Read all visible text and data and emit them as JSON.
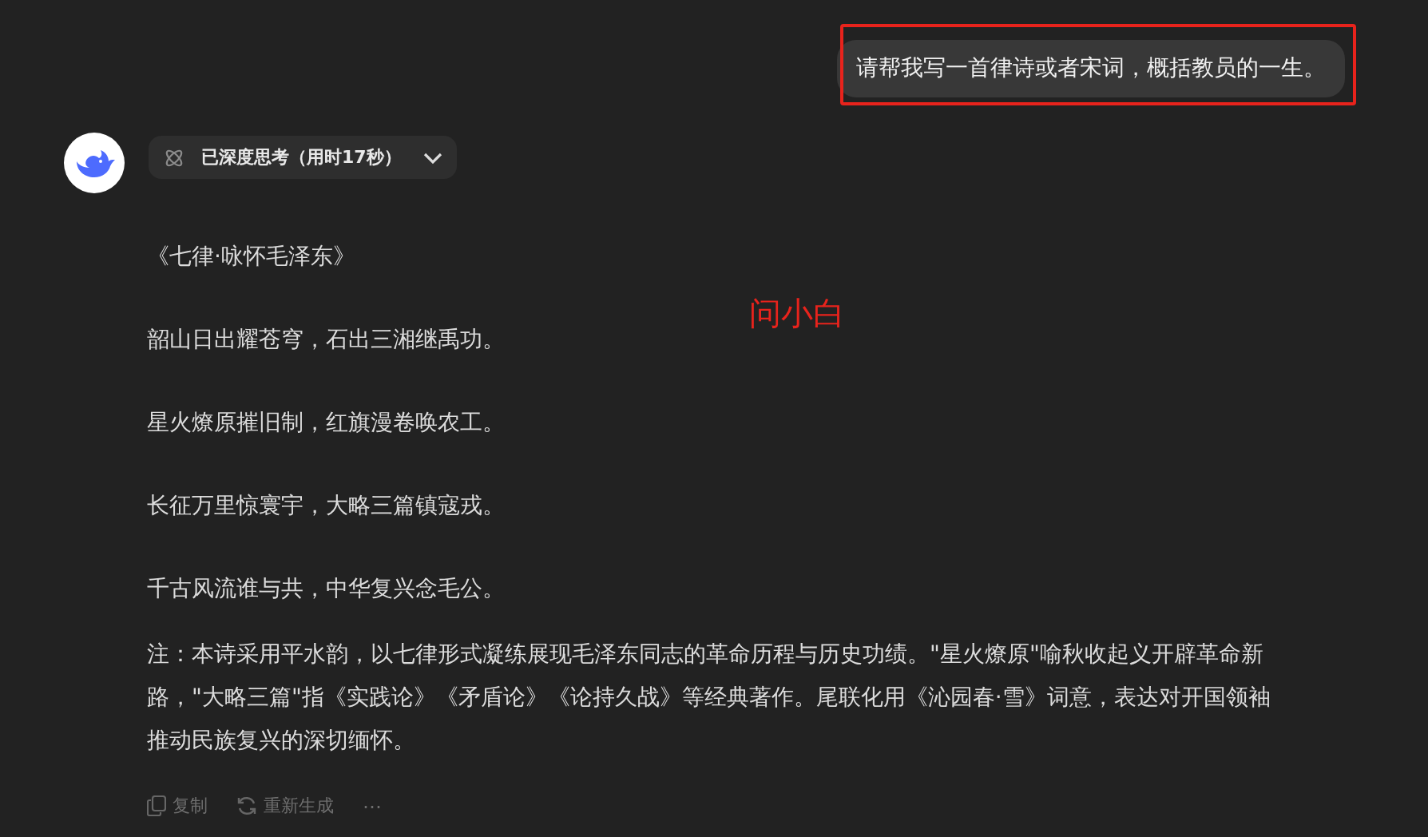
{
  "user_message": {
    "text": "请帮我写一首律诗或者宋词，概括教员的一生。"
  },
  "annotation": {
    "label": "问小白",
    "color": "#e8231c"
  },
  "reply": {
    "thinking": {
      "label": "已深度思考（用时17秒）",
      "expanded": false
    },
    "title": "《七律·咏怀毛泽东》",
    "lines": [
      "韶山日出耀苍穹，石出三湘继禹功。",
      "星火燎原摧旧制，红旗漫卷唤农工。",
      "长征万里惊寰宇，大略三篇镇寇戎。",
      "千古风流谁与共，中华复兴念毛公。"
    ],
    "note": "注：本诗采用平水韵，以七律形式凝练展现毛泽东同志的革命历程与历史功绩。\"星火燎原\"喻秋收起义开辟革命新路，\"大略三篇\"指《实践论》《矛盾论》《论持久战》等经典著作。尾联化用《沁园春·雪》词意，表达对开国领袖推动民族复兴的深切缅怀。",
    "actions": [
      {
        "kind": "copy",
        "label": "复制"
      },
      {
        "kind": "regenerate",
        "label": "重新生成"
      },
      {
        "kind": "more",
        "label": "⋯"
      }
    ]
  }
}
